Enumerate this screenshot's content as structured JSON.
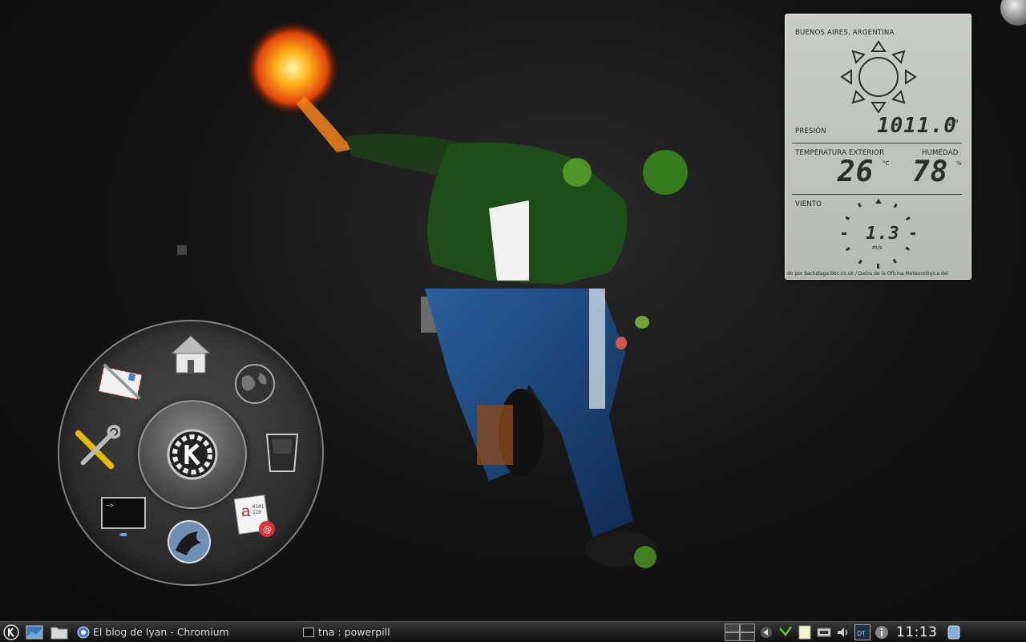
{
  "weather": {
    "location": "BUENOS AIRES, ARGENTINA",
    "pressure_label": "PRESIÓN",
    "pressure_value": "1011.0",
    "pressure_unit": "hPa",
    "temp_label": "TEMPERATURA EXTERIOR",
    "temp_value": "26",
    "temp_unit": "°C",
    "humidity_label": "HUMEDAD",
    "humidity_value": "78",
    "humidity_unit": "%",
    "wind_label": "VIENTO",
    "wind_value": "1.3",
    "wind_unit": "m/s",
    "credit": "do por backstage.bbc.co.uk / Datos de la Oficina Meteorológica del"
  },
  "launcher": {
    "items": [
      {
        "icon": "home-icon"
      },
      {
        "icon": "globe-icon"
      },
      {
        "icon": "trash-icon"
      },
      {
        "icon": "text-editor-icon"
      },
      {
        "icon": "amarok-icon"
      },
      {
        "icon": "terminal-icon"
      },
      {
        "icon": "tools-icon"
      },
      {
        "icon": "mail-icon"
      }
    ],
    "center_icon": "kde-icon"
  },
  "taskbar": {
    "tasks": [
      {
        "label": "El blog de lyan - Chromium",
        "icon": "chromium-icon"
      },
      {
        "label": "tna : powerpill",
        "icon": "terminal-icon"
      }
    ],
    "clock": "11:13",
    "tray_icons": [
      "arrow-left-icon",
      "network-icon",
      "clipboard-icon",
      "device-icon",
      "volume-icon",
      "dt-icon",
      "info-icon"
    ]
  },
  "colors": {
    "widget_bg": "#c0c3be",
    "taskbar_bg": "#1c1c1c",
    "desktop_bg": "#151515"
  }
}
